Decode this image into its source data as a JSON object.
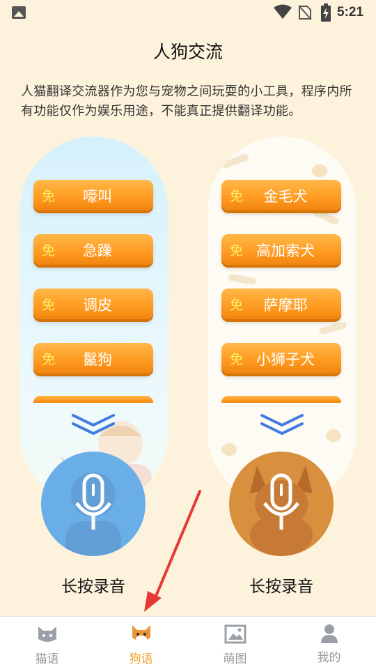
{
  "status_bar": {
    "time": "5:21"
  },
  "header": {
    "title": "人狗交流",
    "description": "人猫翻译交流器作为您与宠物之间玩耍的小工具，程序内所有功能仅作为娱乐用途，不能真正提供翻译功能。"
  },
  "left_panel": {
    "free_badge": "免",
    "items": [
      {
        "label": "嚎叫"
      },
      {
        "label": "急躁"
      },
      {
        "label": "调皮"
      },
      {
        "label": "鬣狗"
      }
    ],
    "record_label": "长按录音"
  },
  "right_panel": {
    "free_badge": "免",
    "items": [
      {
        "label": "金毛犬"
      },
      {
        "label": "高加索犬"
      },
      {
        "label": "萨摩耶"
      },
      {
        "label": "小狮子犬"
      }
    ],
    "record_label": "长按录音"
  },
  "tabs": [
    {
      "label": "猫语",
      "icon": "cat-icon"
    },
    {
      "label": "狗语",
      "icon": "dog-icon"
    },
    {
      "label": "萌图",
      "icon": "image-icon"
    },
    {
      "label": "我的",
      "icon": "person-icon"
    }
  ],
  "active_tab": "狗语",
  "colors": {
    "background": "#fdf3dc",
    "button_orange": "#ff9a1f",
    "free_badge": "#fff06a",
    "active_tab": "#f0a030",
    "chevron": "#3f7be0",
    "annotation_arrow": "#e53935"
  }
}
